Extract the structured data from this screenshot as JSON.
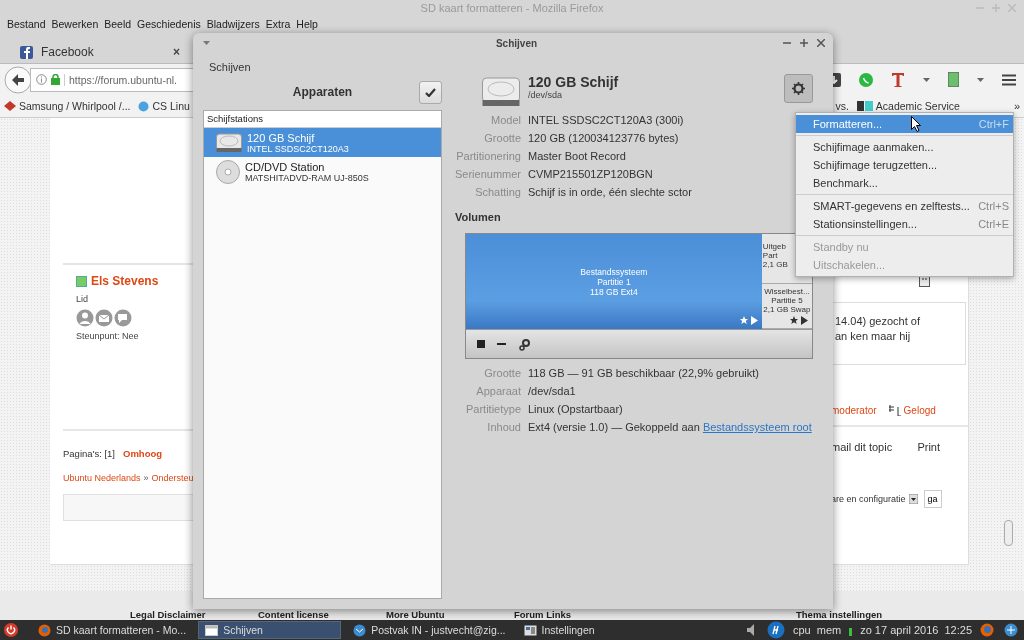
{
  "firefox": {
    "title": "SD kaart formatteren - Mozilla Firefox",
    "menu": [
      "Bestand",
      "Bewerken",
      "Beeld",
      "Geschiedenis",
      "Bladwijzers",
      "Extra",
      "Help"
    ],
    "tabs": [
      {
        "label": "Facebook",
        "close": "×",
        "selected": false
      }
    ],
    "url": "https://forum.ubuntu-nl.",
    "bookmarks_left": [
      "Samsung / Whirlpool /...",
      "CS Linu"
    ],
    "bookmarks_right": [
      "vs.",
      "Academic Service"
    ],
    "bookmarks_more": "»"
  },
  "page": {
    "user": {
      "name": "Els Stevens",
      "online": true,
      "role": "Lid",
      "support_label": "Steunpunt:",
      "support_value": "Nee"
    },
    "pages_label": "Pagina's:",
    "pages_current": "[1]",
    "top_link": "Omhoog",
    "breadcrumb": [
      "Ubuntu Nederlands",
      "»",
      "Ondersteu"
    ],
    "post_lines": [
      "14.04) gezocht of",
      "an ken maar hij"
    ],
    "moderator_link": "moderator",
    "logged_label": "Gelogd",
    "actions": [
      "mail dit topic",
      "Print"
    ],
    "jump_select": "are en configuratie",
    "jump_button": "ga",
    "footer": [
      "Legal Disclaimer",
      "Content license",
      "More Ubuntu",
      "Forum Links",
      "Thema instellingen"
    ]
  },
  "dialog": {
    "title": "Schijven",
    "heading": "Schijven",
    "devices_title": "Apparaten",
    "section": "Schijfstations",
    "devices": [
      {
        "kind": "disk",
        "name": "120 GB Schijf",
        "model": "INTEL SSDSC2CT120A3",
        "selected": true
      },
      {
        "kind": "optical",
        "name": "CD/DVD Station",
        "model": "MATSHITADVD-RAM UJ-850S",
        "selected": false
      }
    ],
    "disk": {
      "name": "120 GB Schijf",
      "path": "/dev/sda"
    },
    "properties": [
      {
        "label": "Model",
        "value": "INTEL SSDSC2CT120A3 (300i)"
      },
      {
        "label": "Grootte",
        "value": "120 GB (120034123776 bytes)"
      },
      {
        "label": "Partitionering",
        "value": "Master Boot Record"
      },
      {
        "label": "Serienummer",
        "value": "CVMP215501ZP120BGN"
      },
      {
        "label": "Schatting",
        "value": "Schijf is in orde, één slechte sctor"
      }
    ],
    "volumes_title": "Volumen",
    "partitions": [
      {
        "lines": [
          "Bestandssysteem",
          "Partitie 1",
          "118 GB Ext4"
        ],
        "selected": true,
        "level": 0.855
      },
      {
        "lines": [
          "Uitgeb",
          "Part",
          "2,1 GB"
        ],
        "selected": false
      },
      {
        "lines": [
          "Wisselbest...",
          "Partitie 5",
          "2,1 GB Swap"
        ],
        "selected": false
      }
    ],
    "volume_properties": [
      {
        "label": "Grootte",
        "value": "118 GB — 91 GB beschikbaar (22,9% gebruikt)"
      },
      {
        "label": "Apparaat",
        "value": "/dev/sda1"
      },
      {
        "label": "Partitietype",
        "value": "Linux (Opstartbaar)"
      },
      {
        "label": "Inhoud",
        "value": "Ext4 (versie 1.0) — Gekoppeld aan ",
        "link": "Bestandssysteem root"
      }
    ]
  },
  "menu": {
    "groups": [
      [
        {
          "label": "Formatteren...",
          "shortcut": "Ctrl+F",
          "selected": true,
          "disabled": false
        }
      ],
      [
        {
          "label": "Schijfimage aanmaken...",
          "selected": false,
          "disabled": false
        },
        {
          "label": "Schijfimage terugzetten...",
          "selected": false,
          "disabled": false
        },
        {
          "label": "Benchmark...",
          "selected": false,
          "disabled": false
        }
      ],
      [
        {
          "label": "SMART-gegevens en zelftests...",
          "shortcut": "Ctrl+S",
          "selected": false,
          "disabled": false
        },
        {
          "label": "Stationsinstellingen...",
          "shortcut": "Ctrl+E",
          "selected": false,
          "disabled": false
        }
      ],
      [
        {
          "label": "Standby nu",
          "selected": false,
          "disabled": true
        },
        {
          "label": "Uitschakelen...",
          "selected": false,
          "disabled": true
        }
      ]
    ]
  },
  "taskbar": {
    "items": [
      {
        "kind": "firefox",
        "label": "SD kaart formatteren - Mo...",
        "selected": false
      },
      {
        "kind": "window",
        "label": "Schijven",
        "selected": true
      },
      {
        "kind": "mail",
        "label": "Postvak IN - justvecht@zig...",
        "selected": false
      },
      {
        "kind": "settings",
        "label": "Instellingen",
        "selected": false
      }
    ],
    "cpu": "cpu",
    "mem": "mem",
    "date": "zo 17 april 2016",
    "time": "12:25"
  }
}
